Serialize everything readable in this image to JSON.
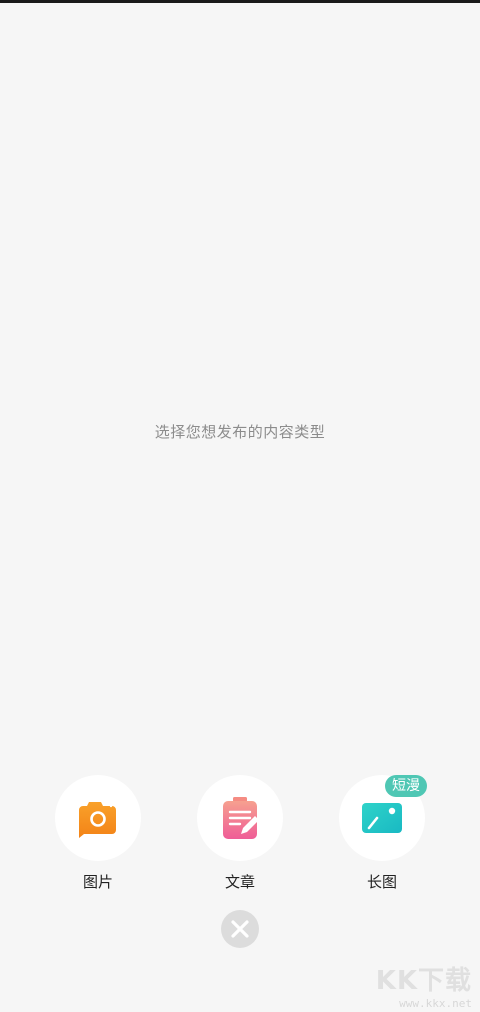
{
  "prompt": {
    "text": "选择您想发布的内容类型"
  },
  "options": [
    {
      "label": "图片",
      "icon": "camera-icon",
      "color": "#f7931e"
    },
    {
      "label": "文章",
      "icon": "notepad-pen-icon",
      "color": "#f06fa0"
    },
    {
      "label": "长图",
      "icon": "image-icon",
      "color": "#22c7c0",
      "badge": "短漫"
    }
  ],
  "close": {
    "icon": "close-icon"
  },
  "watermark": {
    "logo": "KK下载",
    "url": "www.kkx.net"
  }
}
